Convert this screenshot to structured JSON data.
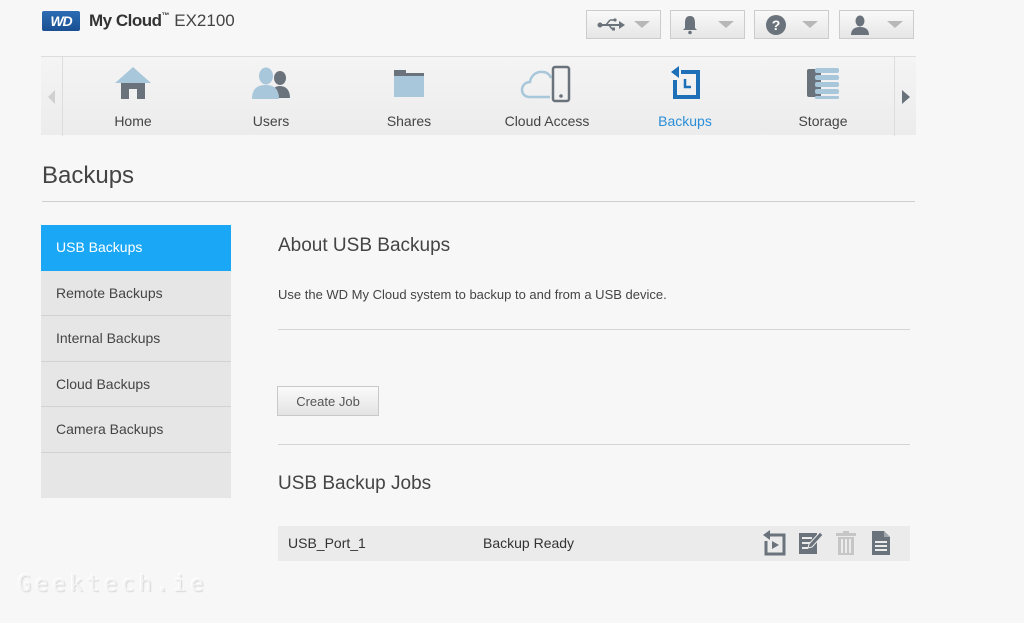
{
  "header": {
    "logo_text": "WD",
    "product_name": "My Cloud",
    "trademark": "™",
    "model": "EX2100",
    "buttons": [
      {
        "icon": "usb-icon",
        "label": "USB"
      },
      {
        "icon": "bell-icon",
        "label": "Notifications"
      },
      {
        "icon": "help-icon",
        "label": "Help"
      },
      {
        "icon": "user-icon",
        "label": "User"
      }
    ]
  },
  "nav": {
    "items": [
      {
        "label": "Home",
        "icon": "home-icon",
        "active": false
      },
      {
        "label": "Users",
        "icon": "users-icon",
        "active": false
      },
      {
        "label": "Shares",
        "icon": "folder-icon",
        "active": false
      },
      {
        "label": "Cloud Access",
        "icon": "cloud-phone-icon",
        "active": false
      },
      {
        "label": "Backups",
        "icon": "backup-icon",
        "active": true
      },
      {
        "label": "Storage",
        "icon": "storage-icon",
        "active": false
      }
    ]
  },
  "page": {
    "title": "Backups"
  },
  "sidebar": {
    "items": [
      {
        "label": "USB Backups",
        "active": true
      },
      {
        "label": "Remote Backups",
        "active": false
      },
      {
        "label": "Internal Backups",
        "active": false
      },
      {
        "label": "Cloud Backups",
        "active": false
      },
      {
        "label": "Camera Backups",
        "active": false
      }
    ]
  },
  "content": {
    "about_heading": "About USB Backups",
    "about_text": "Use the WD My Cloud system to backup to and from a USB device.",
    "create_job_label": "Create Job",
    "jobs_heading": "USB Backup Jobs",
    "jobs": [
      {
        "name": "USB_Port_1",
        "status": "Backup Ready"
      }
    ],
    "job_actions": [
      "restore-icon",
      "edit-icon",
      "delete-icon",
      "details-icon"
    ]
  },
  "colors": {
    "accent": "#1aa7f5",
    "nav_active": "#2a8ed8"
  },
  "watermark": "Geektech.ie"
}
